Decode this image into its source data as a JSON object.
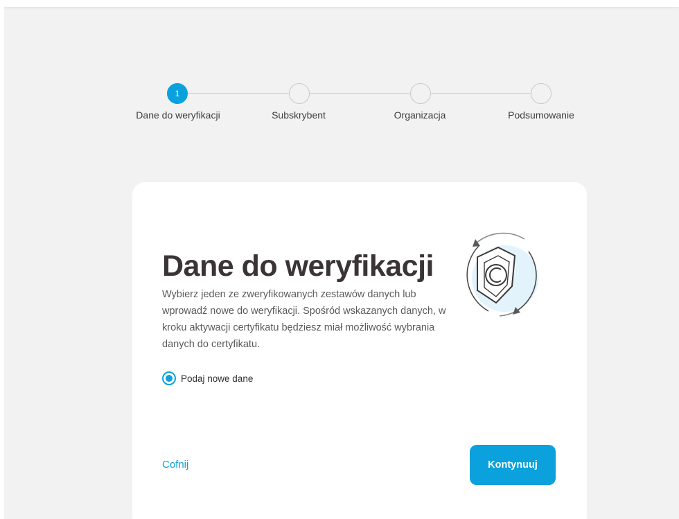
{
  "stepper": {
    "steps": [
      {
        "number": "1",
        "label": "Dane do weryfikacji"
      },
      {
        "number": "",
        "label": "Subskrybent"
      },
      {
        "number": "",
        "label": "Organizacja"
      },
      {
        "number": "",
        "label": "Podsumowanie"
      }
    ],
    "active_step": 1
  },
  "card": {
    "title": "Dane do weryfikacji",
    "description": "Wybierz jeden ze zweryfikowanych zestawów danych lub wprowadź nowe do weryfikacji. Spośród wskazanych danych, w kroku aktywacji certyfikatu będziesz miał możliwość wybrania danych do certyfikatu.",
    "radio_option": {
      "label": "Podaj nowe dane",
      "checked": true
    },
    "back_label": "Cofnij",
    "continue_label": "Kontynuuj",
    "illustration_icon": "shield-certificate-icon"
  },
  "colors": {
    "accent": "#0aa1dd",
    "background": "#f2f2f2",
    "card": "#ffffff"
  }
}
